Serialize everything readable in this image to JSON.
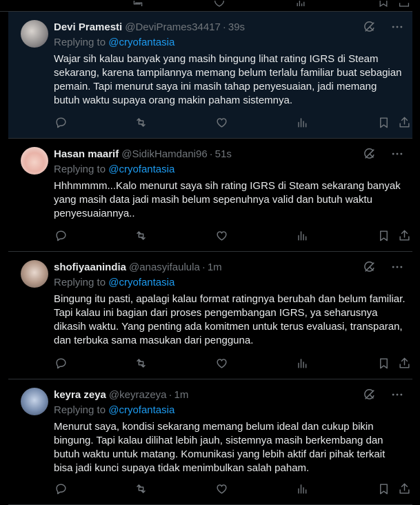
{
  "tweets": [
    {
      "name": "Devi Pramesti",
      "handle": "@DeviPrames34417",
      "sep": "·",
      "time": "39s",
      "replying_prefix": "Replying to ",
      "mention": "@cryofantasia",
      "text": "Wajar sih kalau banyak yang masih bingung lihat rating IGRS di Steam sekarang, karena tampilannya memang belum terlalu familiar buat sebagian pemain. Tapi menurut saya ini masih tahap penyesuaian, jadi memang butuh waktu supaya orang makin paham sistemnya."
    },
    {
      "name": "Hasan maarif",
      "handle": "@SidikHamdani96",
      "sep": "·",
      "time": "51s",
      "replying_prefix": "Replying to ",
      "mention": "@cryofantasia",
      "text": "Hhhmmmm...Kalo menurut saya sih rating IGRS di Steam sekarang banyak yang masih data jadi masih belum sepenuhnya valid dan butuh waktu penyesuaiannya.."
    },
    {
      "name": "shofiyaanindia",
      "handle": "@anasyifaulula",
      "sep": "·",
      "time": "1m",
      "replying_prefix": "Replying to ",
      "mention": "@cryofantasia",
      "text": "Bingung itu pasti, apalagi kalau format ratingnya berubah dan belum familiar. Tapi kalau ini bagian dari proses pengembangan IGRS, ya seharusnya dikasih waktu. Yang penting ada komitmen untuk terus evaluasi, transparan, dan terbuka sama masukan dari pengguna."
    },
    {
      "name": "keyra zeya",
      "handle": "@keyrazeya",
      "sep": "·",
      "time": "1m",
      "replying_prefix": "Replying to ",
      "mention": "@cryofantasia",
      "text": "Menurut saya, kondisi sekarang memang belum ideal dan cukup bikin bingung. Tapi kalau dilihat lebih jauh, sistemnya masih berkembang dan butuh waktu untuk matang. Komunikasi yang lebih aktif dari pihak terkait bisa jadi kunci supaya tidak menimbulkan salah paham."
    }
  ],
  "icons": {
    "grok": "grok-icon",
    "more": "more-icon",
    "reply": "reply-icon",
    "retweet": "retweet-icon",
    "like": "like-icon",
    "views": "views-icon",
    "bookmark": "bookmark-icon",
    "share": "share-icon"
  },
  "colors": {
    "background": "#000000",
    "highlight": "#0c1825",
    "text": "#e7e9ea",
    "secondary": "#71767b",
    "link": "#1d9bf0",
    "border": "#2f3336"
  }
}
